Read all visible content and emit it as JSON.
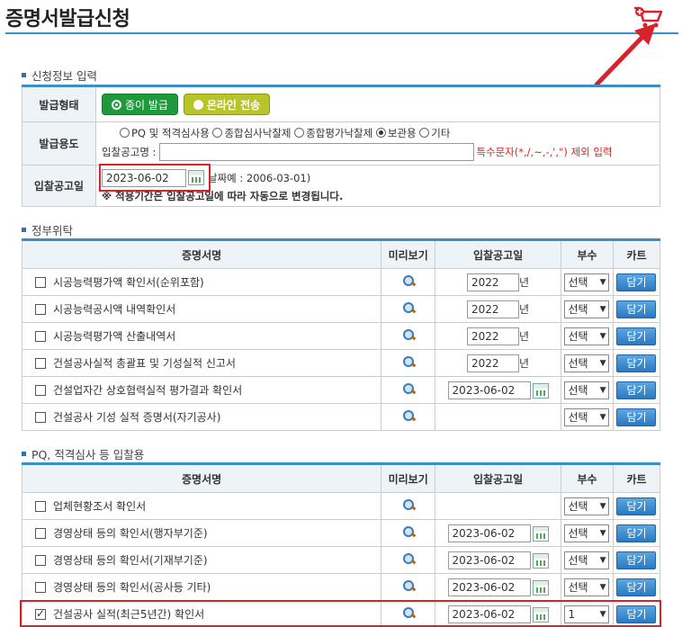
{
  "page": {
    "title": "증명서발급신청"
  },
  "applicant_section": {
    "label": "신청정보 입력",
    "issue_type": {
      "label": "발급형태",
      "paper_btn": "종이 발급",
      "online_btn": "온라인 전송"
    },
    "purpose": {
      "label": "발급용도",
      "options": [
        "PQ 및 적격심사용",
        "종합심사낙찰제",
        "종합평가낙찰제",
        "보관용",
        "기타"
      ],
      "selected_index": 3,
      "notice_label": "입찰공고명 :",
      "notice_hint": "특수문자(*,/,~,-,',\") 제외 입력"
    },
    "bid_date": {
      "label": "입찰공고일",
      "value": "2023-06-02",
      "example": "날짜예 : 2006-03-01)",
      "note": "※ 적용기간은 입찰공고일에 따라 자동으로 변경됩니다."
    }
  },
  "gov_section": {
    "label": "정부위탁",
    "headers": [
      "증명서명",
      "미리보기",
      "입찰공고일",
      "부수",
      "카트"
    ],
    "rows": [
      {
        "name": "시공능력평가액 확인서(순위포함)",
        "date": "2022",
        "unit": "년",
        "date_type": "year",
        "qty": "선택",
        "checked": false
      },
      {
        "name": "시공능력공시액 내역확인서",
        "date": "2022",
        "unit": "년",
        "date_type": "year",
        "qty": "선택",
        "checked": false
      },
      {
        "name": "시공능력평가액 산출내역서",
        "date": "2022",
        "unit": "년",
        "date_type": "year",
        "qty": "선택",
        "checked": false
      },
      {
        "name": "건설공사실적 총괄표 및 기성실적 신고서",
        "date": "2022",
        "unit": "년",
        "date_type": "year",
        "qty": "선택",
        "checked": false
      },
      {
        "name": "건설업자간 상호협력실적 평가결과 확인서",
        "date": "2023-06-02",
        "unit": "",
        "date_type": "date",
        "qty": "선택",
        "checked": false
      },
      {
        "name": "건설공사 기성 실적 증명서(자기공사)",
        "date": "",
        "unit": "",
        "date_type": "none",
        "qty": "선택",
        "checked": false
      }
    ]
  },
  "pq_section": {
    "label": "PQ, 적격심사 등 입찰용",
    "headers": [
      "증명서명",
      "미리보기",
      "입찰공고일",
      "부수",
      "카트"
    ],
    "rows": [
      {
        "name": "업체현황조서 확인서",
        "date": "",
        "date_type": "none",
        "qty": "선택",
        "checked": false
      },
      {
        "name": "경영상태 등의 확인서(행자부기준)",
        "date": "2023-06-02",
        "date_type": "date",
        "qty": "선택",
        "checked": false
      },
      {
        "name": "경영상태 등의 확인서(기재부기준)",
        "date": "2023-06-02",
        "date_type": "date",
        "qty": "선택",
        "checked": false
      },
      {
        "name": "경영상태 등의 확인서(공사등 기타)",
        "date": "2023-06-02",
        "date_type": "date",
        "qty": "선택",
        "checked": false
      },
      {
        "name": "건설공사 실적(최근5년간) 확인서",
        "date": "2023-06-02",
        "date_type": "date",
        "qty": "1",
        "checked": true
      }
    ]
  },
  "cart_label": "담기"
}
